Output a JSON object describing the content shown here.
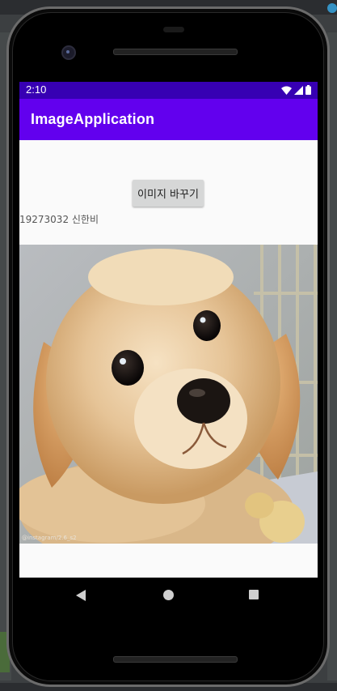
{
  "status_bar": {
    "time": "2:10",
    "icons": [
      "wifi-icon",
      "signal-icon",
      "battery-icon"
    ]
  },
  "app_bar": {
    "title": "ImageApplication"
  },
  "main": {
    "change_button_label": "이미지 바꾸기",
    "student_label": "19273032 신한비",
    "image": {
      "subject": "golden retriever puppy",
      "watermark": "@instagram/2.6_s2"
    }
  },
  "nav_bar": {
    "items": [
      "back-icon",
      "home-icon",
      "recents-icon"
    ]
  },
  "colors": {
    "status_bar": "#3700b3",
    "app_bar": "#6200ee",
    "screen_background": "#fafafa",
    "button_background": "#d6d7d7"
  }
}
